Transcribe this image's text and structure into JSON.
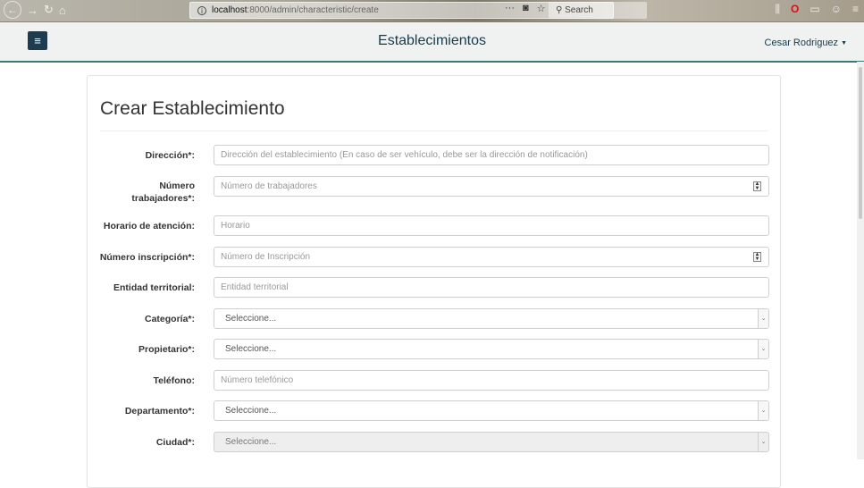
{
  "browser": {
    "url_host": "localhost",
    "url_path": ":8000/admin/characteristic/create",
    "info_glyph": "i",
    "more_glyph": "···",
    "search_placeholder": "Search"
  },
  "navbar": {
    "menu_glyph": "≡",
    "brand": "Establecimientos",
    "user": "Cesar Rodriguez"
  },
  "form": {
    "title": "Crear Establecimiento",
    "fields": [
      {
        "label": "Dirección*:",
        "placeholder": "Dirección del establecimiento (En caso de ser vehículo, debe ser la dirección de notificación)",
        "type": "text"
      },
      {
        "label_line1": "Número",
        "label_line2": "trabajadores*:",
        "placeholder": "Número de trabajadores",
        "type": "number"
      },
      {
        "label": "Horario de atención:",
        "placeholder": "Horario",
        "type": "text"
      },
      {
        "label": "Número inscripción*:",
        "placeholder": "Número de Inscripción",
        "type": "number"
      },
      {
        "label": "Entidad territorial:",
        "placeholder": "Entidad territorial",
        "type": "text"
      },
      {
        "label": "Categoría*:",
        "value": "Seleccione...",
        "type": "select"
      },
      {
        "label": "Propietario*:",
        "value": "Seleccione...",
        "type": "select"
      },
      {
        "label": "Teléfono:",
        "placeholder": "Número telefónico",
        "type": "text"
      },
      {
        "label": "Departamento*:",
        "value": "Seleccione...",
        "type": "select"
      },
      {
        "label": "Ciudad*:",
        "value": "Seleccione...",
        "type": "select",
        "disabled": true
      }
    ]
  },
  "colors": {
    "navbar_accent": "#3f7873",
    "brand_text": "#163b4d",
    "menu_button": "#1d3c4f"
  },
  "icons": [
    "back-icon",
    "forward-icon",
    "reload-icon",
    "home-icon",
    "pocket-icon",
    "bookmark-star-icon",
    "search-icon",
    "library-icon",
    "opera-icon",
    "hamburger-menu-icon"
  ]
}
